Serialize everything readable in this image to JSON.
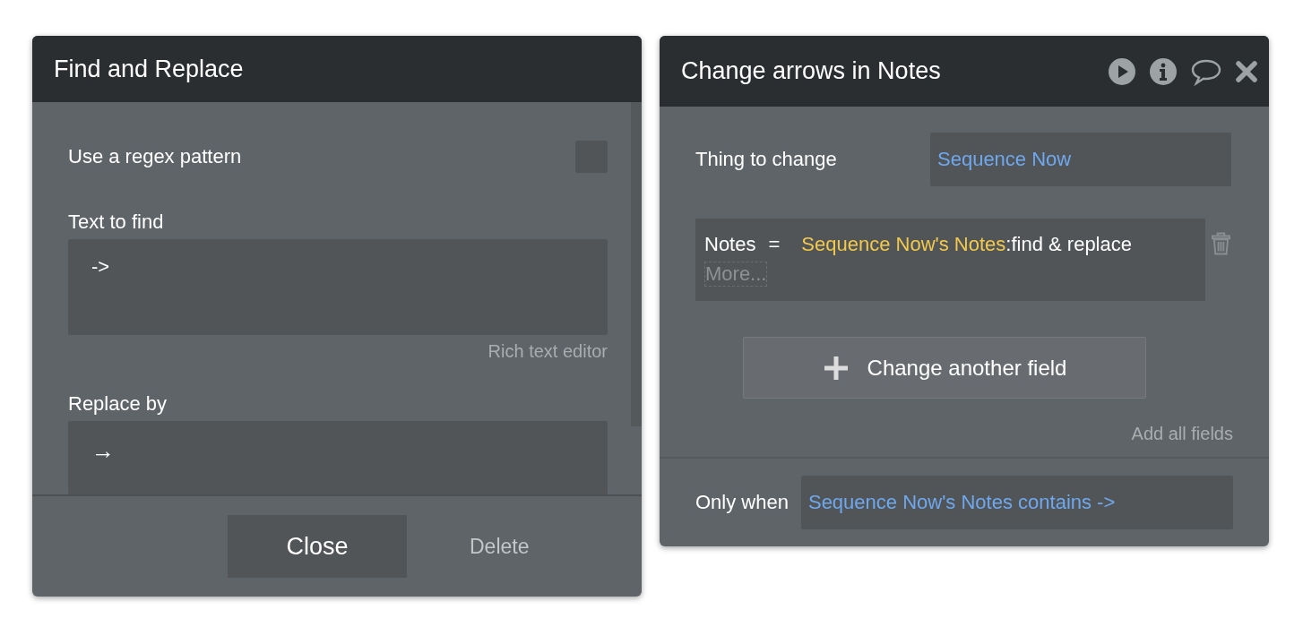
{
  "find_replace_panel": {
    "title": "Find and Replace",
    "regex_option": {
      "label": "Use a regex pattern",
      "checked": false
    },
    "text_to_find": {
      "label": "Text to find",
      "value": "->"
    },
    "rich_text_link": "Rich text editor",
    "replace_by": {
      "label": "Replace by",
      "value": "→"
    },
    "buttons": [
      {
        "label": "Close",
        "kind": "primary"
      },
      {
        "label": "Delete",
        "kind": "link"
      }
    ]
  },
  "action_panel": {
    "title": "Change arrows in Notes",
    "thing_to_change": {
      "label": "Thing to change",
      "value": "Sequence Now"
    },
    "field_changes": [
      {
        "field": "Notes",
        "operator": "=",
        "expression": [
          {
            "text": "Sequence Now's Notes",
            "kind": "dynamic"
          },
          {
            "text": ":find & replace",
            "kind": "operator"
          }
        ],
        "more": "More..."
      }
    ],
    "add_field_button": "Change another field",
    "add_all_link": "Add all fields",
    "only_when": {
      "label": "Only when",
      "value": "Sequence Now's Notes contains ->"
    }
  }
}
